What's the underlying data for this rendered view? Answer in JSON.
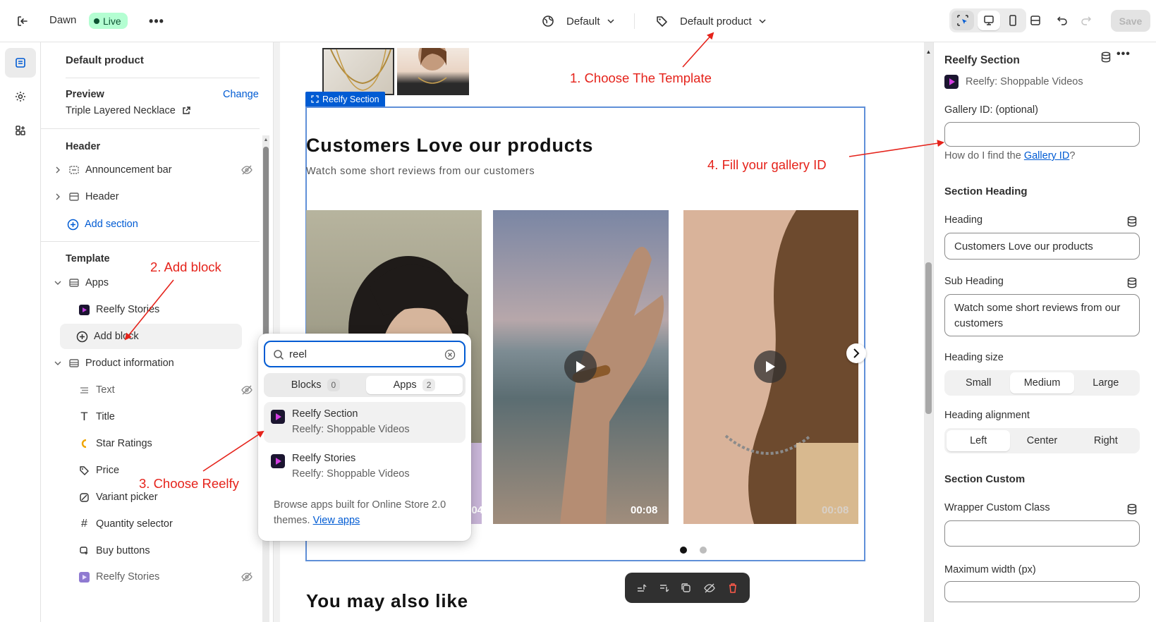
{
  "topbar": {
    "theme_name": "Dawn",
    "status_badge": "Live",
    "theme_selector": "Default",
    "template_selector": "Default product",
    "save_label": "Save"
  },
  "sidebar": {
    "title": "Default product",
    "preview_label": "Preview",
    "preview_change": "Change",
    "preview_product": "Triple Layered Necklace",
    "header_group": "Header",
    "header_items": [
      "Announcement bar",
      "Header"
    ],
    "add_section": "Add section",
    "template_group": "Template",
    "apps_label": "Apps",
    "apps_child": "Reelfy Stories",
    "add_block": "Add block",
    "product_info_label": "Product information",
    "product_blocks": [
      "Text",
      "Title",
      "Star Ratings",
      "Price",
      "Variant picker",
      "Quantity selector",
      "Buy buttons",
      "Reelfy Stories"
    ]
  },
  "popup": {
    "search_value": "reel",
    "tab_blocks": "Blocks",
    "tab_blocks_count": "0",
    "tab_apps": "Apps",
    "tab_apps_count": "2",
    "results": [
      {
        "title": "Reelfy Section",
        "subtitle": "Reelfy: Shoppable Videos"
      },
      {
        "title": "Reelfy Stories",
        "subtitle": "Reelfy: Shoppable Videos"
      }
    ],
    "footer_text": "Browse apps built for Online Store 2.0 themes.",
    "footer_link": "View apps"
  },
  "preview": {
    "section_tag": "Reelfy Section",
    "heading": "Customers Love our products",
    "subheading": "Watch some short reviews from our customers",
    "video_durations": [
      "0:04",
      "00:08",
      "00:08"
    ],
    "next_heading": "You may also like"
  },
  "annotations": {
    "step1": "1. Choose The Template",
    "step2": "2. Add block",
    "step3": "3. Choose Reelfy",
    "step4": "4. Fill your gallery ID"
  },
  "rightpanel": {
    "section_title": "Reelfy Section",
    "app_name": "Reelfy: Shoppable Videos",
    "gallery_label": "Gallery ID: (optional)",
    "gallery_value": "",
    "help_prefix": "How do I find the ",
    "help_link": "Gallery ID",
    "help_suffix": "?",
    "section_heading_title": "Section Heading",
    "heading_label": "Heading",
    "heading_value": "Customers Love our products",
    "subheading_label": "Sub Heading",
    "subheading_value": "Watch some short reviews from our customers",
    "heading_size_label": "Heading size",
    "heading_size_options": [
      "Small",
      "Medium",
      "Large"
    ],
    "heading_size_selected": "Medium",
    "heading_align_label": "Heading alignment",
    "heading_align_options": [
      "Left",
      "Center",
      "Right"
    ],
    "heading_align_selected": "Left",
    "section_custom_title": "Section Custom",
    "wrapper_label": "Wrapper Custom Class",
    "wrapper_value": "",
    "max_width_label": "Maximum width (px)"
  },
  "colors": {
    "accent_blue": "#005bd3",
    "live_green": "#b4fed2",
    "annotation_red": "#e5231b",
    "brand_gradient": "#6c2bd9"
  }
}
